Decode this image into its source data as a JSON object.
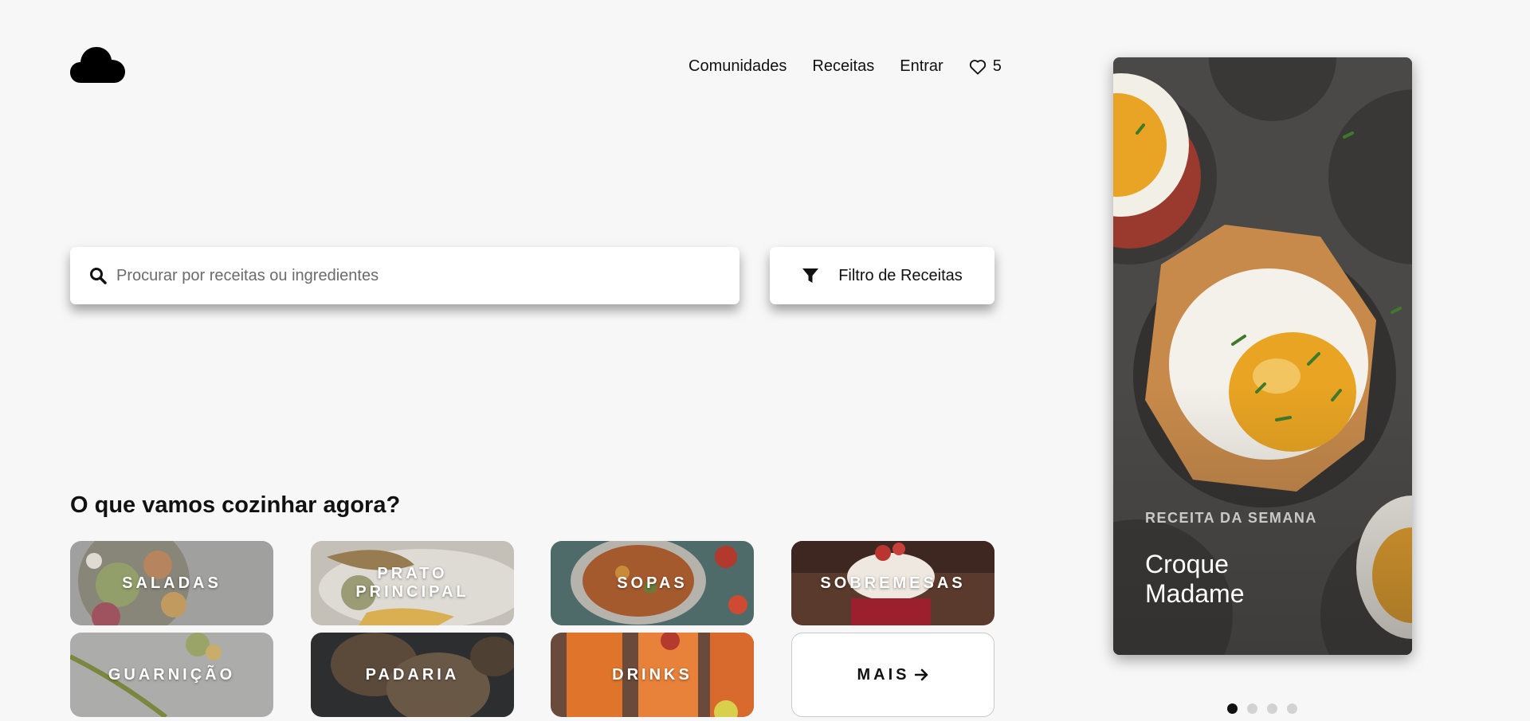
{
  "header": {
    "logo_icon": "cloud-icon",
    "nav": [
      "Comunidades",
      "Receitas",
      "Entrar"
    ],
    "favorites_icon": "heart-icon",
    "favorites_count": "5"
  },
  "search": {
    "icon": "search-icon",
    "placeholder": "Procurar por receitas ou ingredientes",
    "value": ""
  },
  "filter": {
    "icon": "filter-icon",
    "label": "Filtro de Receitas"
  },
  "categories_section": {
    "title": "O que vamos cozinhar agora?",
    "items": [
      "SALADAS",
      "PRATO PRINCIPAL",
      "SOPAS",
      "SOBREMESAS",
      "GUARNIÇÃO",
      "PADARIA",
      "DRINKS"
    ],
    "more_label": "MAIS",
    "more_icon": "arrow-right-icon"
  },
  "featured": {
    "kicker": "RECEITA DA SEMANA",
    "title": "Croque Madame"
  },
  "carousel": {
    "slide_count": 4,
    "active_slide": 1
  }
}
